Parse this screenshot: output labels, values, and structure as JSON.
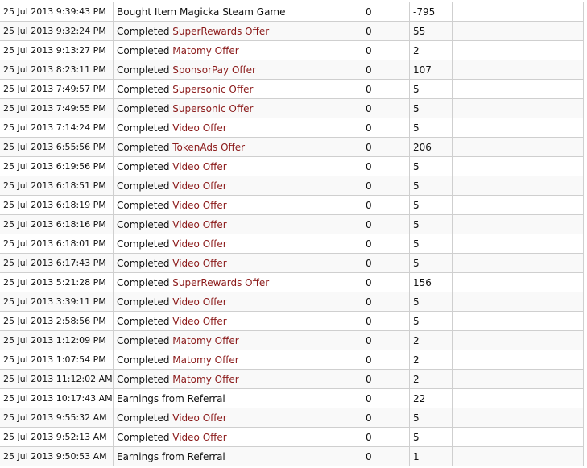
{
  "colors": {
    "offer_link": "#8b1a1a",
    "border": "#cfcfcf",
    "alt_row": "#f9f9f9"
  },
  "rows": [
    {
      "date": "25 Jul 2013 9:39:43 PM",
      "prefix": "Bought Item Magicka Steam Game",
      "offer": "",
      "col3": "0",
      "amount": "-795"
    },
    {
      "date": "25 Jul 2013 9:32:24 PM",
      "prefix": "Completed ",
      "offer": "SuperRewards Offer",
      "col3": "0",
      "amount": "55"
    },
    {
      "date": "25 Jul 2013 9:13:27 PM",
      "prefix": "Completed ",
      "offer": "Matomy Offer",
      "col3": "0",
      "amount": "2"
    },
    {
      "date": "25 Jul 2013 8:23:11 PM",
      "prefix": "Completed ",
      "offer": "SponsorPay Offer",
      "col3": "0",
      "amount": "107"
    },
    {
      "date": "25 Jul 2013 7:49:57 PM",
      "prefix": "Completed ",
      "offer": "Supersonic Offer",
      "col3": "0",
      "amount": "5"
    },
    {
      "date": "25 Jul 2013 7:49:55 PM",
      "prefix": "Completed ",
      "offer": "Supersonic Offer",
      "col3": "0",
      "amount": "5"
    },
    {
      "date": "25 Jul 2013 7:14:24 PM",
      "prefix": "Completed ",
      "offer": "Video Offer",
      "col3": "0",
      "amount": "5"
    },
    {
      "date": "25 Jul 2013 6:55:56 PM",
      "prefix": "Completed ",
      "offer": "TokenAds Offer",
      "col3": "0",
      "amount": "206"
    },
    {
      "date": "25 Jul 2013 6:19:56 PM",
      "prefix": "Completed ",
      "offer": "Video Offer",
      "col3": "0",
      "amount": "5"
    },
    {
      "date": "25 Jul 2013 6:18:51 PM",
      "prefix": "Completed ",
      "offer": "Video Offer",
      "col3": "0",
      "amount": "5"
    },
    {
      "date": "25 Jul 2013 6:18:19 PM",
      "prefix": "Completed ",
      "offer": "Video Offer",
      "col3": "0",
      "amount": "5"
    },
    {
      "date": "25 Jul 2013 6:18:16 PM",
      "prefix": "Completed ",
      "offer": "Video Offer",
      "col3": "0",
      "amount": "5"
    },
    {
      "date": "25 Jul 2013 6:18:01 PM",
      "prefix": "Completed ",
      "offer": "Video Offer",
      "col3": "0",
      "amount": "5"
    },
    {
      "date": "25 Jul 2013 6:17:43 PM",
      "prefix": "Completed ",
      "offer": "Video Offer",
      "col3": "0",
      "amount": "5"
    },
    {
      "date": "25 Jul 2013 5:21:28 PM",
      "prefix": "Completed ",
      "offer": "SuperRewards Offer",
      "col3": "0",
      "amount": "156"
    },
    {
      "date": "25 Jul 2013 3:39:11 PM",
      "prefix": "Completed ",
      "offer": "Video Offer",
      "col3": "0",
      "amount": "5"
    },
    {
      "date": "25 Jul 2013 2:58:56 PM",
      "prefix": "Completed ",
      "offer": "Video Offer",
      "col3": "0",
      "amount": "5"
    },
    {
      "date": "25 Jul 2013 1:12:09 PM",
      "prefix": "Completed ",
      "offer": "Matomy Offer",
      "col3": "0",
      "amount": "2"
    },
    {
      "date": "25 Jul 2013 1:07:54 PM",
      "prefix": "Completed ",
      "offer": "Matomy Offer",
      "col3": "0",
      "amount": "2"
    },
    {
      "date": "25 Jul 2013 11:12:02 AM",
      "prefix": "Completed ",
      "offer": "Matomy Offer",
      "col3": "0",
      "amount": "2"
    },
    {
      "date": "25 Jul 2013 10:17:43 AM",
      "prefix": "Earnings from Referral",
      "offer": "",
      "col3": "0",
      "amount": "22"
    },
    {
      "date": "25 Jul 2013 9:55:32 AM",
      "prefix": "Completed ",
      "offer": "Video Offer",
      "col3": "0",
      "amount": "5"
    },
    {
      "date": "25 Jul 2013 9:52:13 AM",
      "prefix": "Completed ",
      "offer": "Video Offer",
      "col3": "0",
      "amount": "5"
    },
    {
      "date": "25 Jul 2013 9:50:53 AM",
      "prefix": "Earnings from Referral",
      "offer": "",
      "col3": "0",
      "amount": "1"
    }
  ]
}
